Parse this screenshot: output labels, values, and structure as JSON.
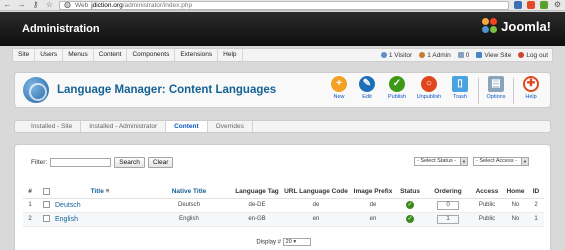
{
  "browser": {
    "web_tag": "Web",
    "url_host": "jdiction.org",
    "url_path": "/administrator/index.php"
  },
  "header": {
    "title": "Administration",
    "logo_text": "Joomla!"
  },
  "menu": {
    "items": [
      "Site",
      "Users",
      "Menus",
      "Content",
      "Components",
      "Extensions",
      "Help"
    ],
    "visitors": "1 Visitor",
    "admins": "1 Admin",
    "messages": "0",
    "view_site": "View Site",
    "logout": "Log out"
  },
  "toolbar": {
    "heading": "Language Manager: Content Languages",
    "buttons": [
      {
        "label": "New",
        "color": "#f3a125",
        "glyph": "+"
      },
      {
        "label": "Edit",
        "color": "#1d6fb8",
        "glyph": "✎"
      },
      {
        "label": "Publish",
        "color": "#3d9a18",
        "glyph": "✓"
      },
      {
        "label": "Unpublish",
        "color": "#e0471c",
        "glyph": "○"
      },
      {
        "label": "Trash",
        "color": "#4aa3df",
        "glyph": "▯"
      },
      {
        "label": "Options",
        "color": "#8a9fb5",
        "glyph": "▤"
      },
      {
        "label": "Help",
        "color": "#ffffff",
        "glyph": "✚"
      }
    ]
  },
  "submenu": {
    "tabs": [
      "Installed - Site",
      "Installed - Administrator",
      "Content",
      "Overrides"
    ],
    "active_index": 2
  },
  "filters": {
    "label": "Filter:",
    "search_button": "Search",
    "clear_button": "Clear",
    "status_select": "- Select Status -",
    "access_select": "- Select Access -"
  },
  "table": {
    "headers": [
      "#",
      "",
      "Title",
      "Native Title",
      "Language Tag",
      "URL Language Code",
      "Image Prefix",
      "Status",
      "Ordering",
      "Access",
      "Home",
      "ID"
    ],
    "rows": [
      {
        "num": "1",
        "title": "Deutsch",
        "native": "Deutsch",
        "tag": "de-DE",
        "url_code": "de",
        "prefix": "de",
        "ordering": "0",
        "access": "Public",
        "home": "No",
        "id": "2"
      },
      {
        "num": "2",
        "title": "English",
        "native": "English",
        "tag": "en-GB",
        "url_code": "en",
        "prefix": "en",
        "ordering": "1",
        "access": "Public",
        "home": "No",
        "id": "1"
      }
    ]
  },
  "pagination": {
    "display_label": "Display #",
    "display_value": "20"
  },
  "colors": {
    "accent": "#146295",
    "link": "#0b55c4",
    "published": "#3b8a1e"
  }
}
